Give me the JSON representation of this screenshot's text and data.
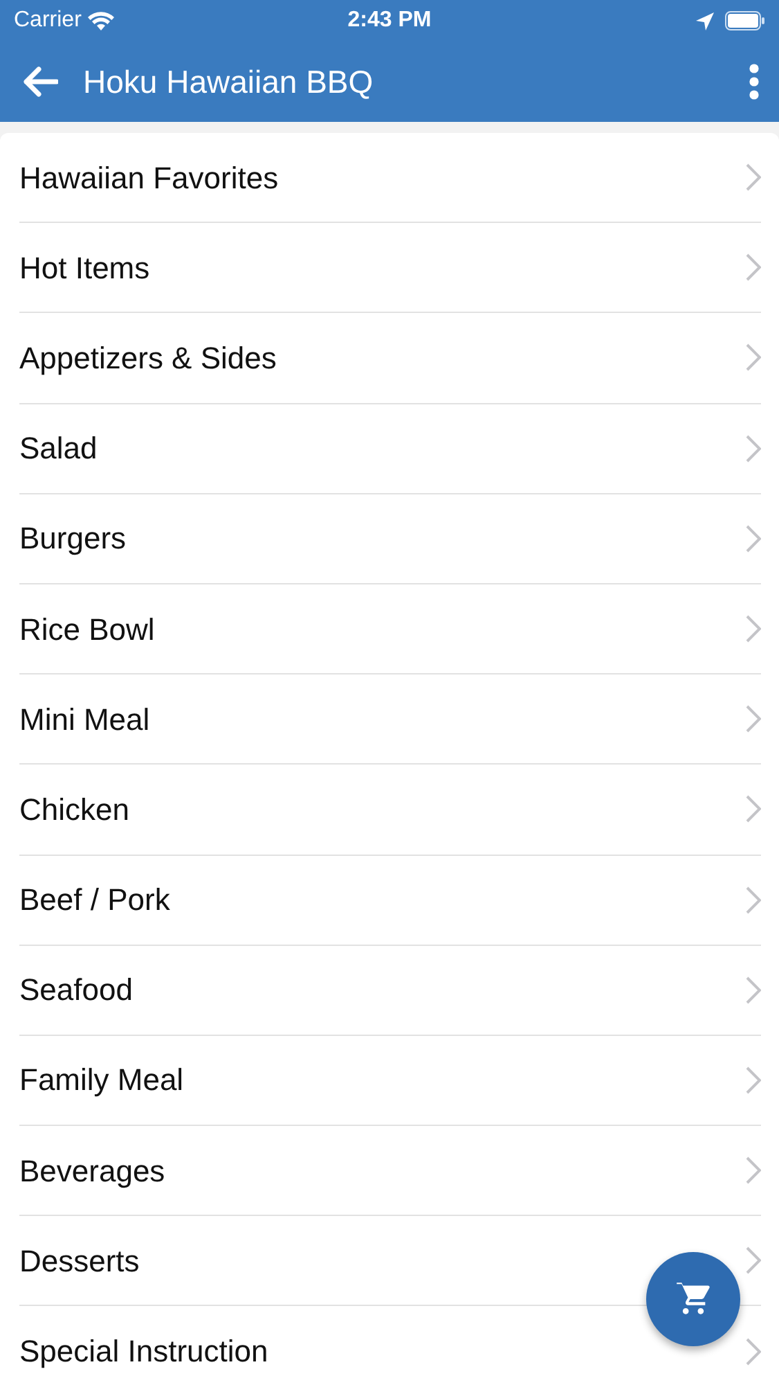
{
  "status_bar": {
    "carrier": "Carrier",
    "time": "2:43 PM"
  },
  "app_bar": {
    "title": "Hoku Hawaiian BBQ"
  },
  "menu_categories": [
    {
      "label": "Hawaiian Favorites"
    },
    {
      "label": "Hot Items"
    },
    {
      "label": "Appetizers & Sides"
    },
    {
      "label": "Salad"
    },
    {
      "label": "Burgers"
    },
    {
      "label": "Rice Bowl"
    },
    {
      "label": "Mini Meal"
    },
    {
      "label": "Chicken"
    },
    {
      "label": "Beef / Pork"
    },
    {
      "label": "Seafood"
    },
    {
      "label": "Family Meal"
    },
    {
      "label": "Beverages"
    },
    {
      "label": "Desserts"
    },
    {
      "label": "Special Instruction"
    }
  ]
}
